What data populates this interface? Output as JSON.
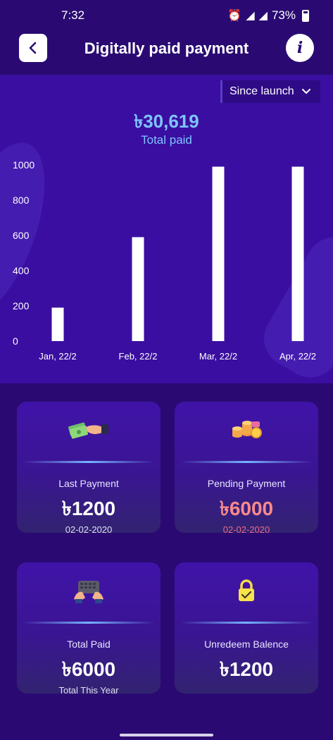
{
  "status_bar": {
    "time": "7:32",
    "battery": "73%"
  },
  "header": {
    "title": "Digitally paid payment"
  },
  "summary": {
    "range": "Since launch",
    "total_amount": "৳30,619",
    "total_label": "Total paid"
  },
  "chart_data": {
    "type": "bar",
    "categories": [
      "Jan, 22/2",
      "Feb, 22/2",
      "Mar, 22/2",
      "Apr, 22/2"
    ],
    "values": [
      190,
      590,
      990,
      990
    ],
    "yticks": [
      0,
      200,
      400,
      600,
      800,
      1000
    ],
    "ylim": [
      0,
      1000
    ],
    "bar_color": "#ffffff",
    "grid": false
  },
  "cards": [
    {
      "icon": "money-payment-icon",
      "label": "Last Payment",
      "value": "৳1200",
      "sub": "02-02-2020",
      "value_color": "#ffffff",
      "sub_color": "#e0dcf5"
    },
    {
      "icon": "coins-icon",
      "label": "Pending Payment",
      "value": "৳6000",
      "sub": "02-02-2020",
      "value_color": "#f98a8a",
      "sub_color": "#e86a8a"
    },
    {
      "icon": "keyboard-hands-icon",
      "label": "Total Paid",
      "value": "৳6000",
      "sub": "Total This Year",
      "value_color": "#ffffff",
      "sub_color": "#e0dcf5"
    },
    {
      "icon": "lock-icon",
      "label": "Unredeem Balence",
      "value": "৳1200",
      "sub": "",
      "value_color": "#ffffff",
      "sub_color": "#e0dcf5"
    }
  ]
}
